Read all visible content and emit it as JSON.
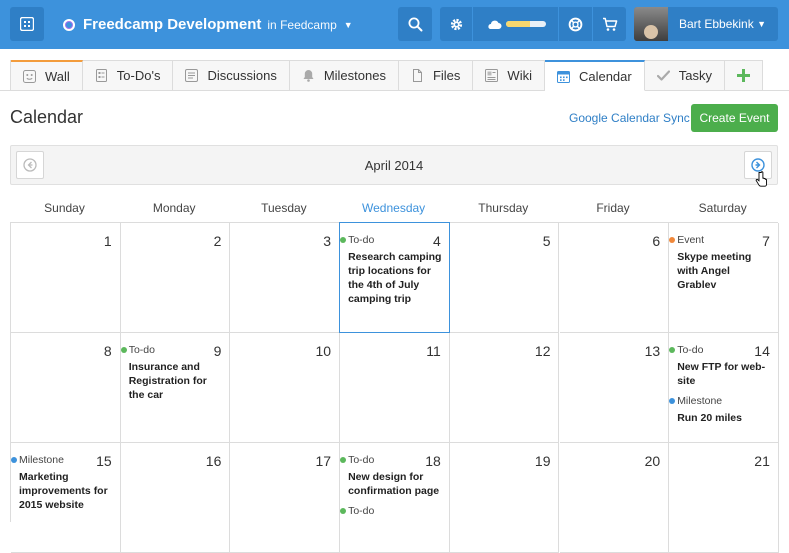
{
  "topbar": {
    "project_name": "Freedcamp Development",
    "project_in": "in Feedcamp",
    "user_name": "Bart Ebbekink",
    "storage_fraction": 0.6
  },
  "tabs": [
    {
      "label": "Wall",
      "icon": "smiley-icon"
    },
    {
      "label": "To-Do's",
      "icon": "todo-icon"
    },
    {
      "label": "Discussions",
      "icon": "discussion-icon"
    },
    {
      "label": "Milestones",
      "icon": "bell-icon"
    },
    {
      "label": "Files",
      "icon": "file-icon"
    },
    {
      "label": "Wiki",
      "icon": "wiki-icon"
    },
    {
      "label": "Calendar",
      "icon": "calendar-icon"
    },
    {
      "label": "Tasky",
      "icon": "check-icon"
    }
  ],
  "header": {
    "title": "Calendar",
    "gcal_sync": "Google Calendar Sync",
    "create_event": "Create Event"
  },
  "calendar": {
    "month_label": "April 2014",
    "days_of_week": [
      "Sunday",
      "Monday",
      "Tuesday",
      "Wednesday",
      "Thursday",
      "Friday",
      "Saturday"
    ],
    "today_dow_index": 3,
    "weeks": [
      [
        {
          "day": "1",
          "events": []
        },
        {
          "day": "2",
          "events": []
        },
        {
          "day": "3",
          "events": []
        },
        {
          "day": "4",
          "today": true,
          "events": [
            {
              "type": "To-do",
              "color": "#5cb85c",
              "title": "Research camping trip locations for the 4th of July camping trip"
            }
          ]
        },
        {
          "day": "5",
          "events": []
        },
        {
          "day": "6",
          "events": []
        },
        {
          "day": "7",
          "events": [
            {
              "type": "Event",
              "color": "#f0883a",
              "title": "Skype meeting with Angel Grablev"
            }
          ]
        }
      ],
      [
        {
          "day": "8",
          "events": []
        },
        {
          "day": "9",
          "events": [
            {
              "type": "To-do",
              "color": "#5cb85c",
              "title": "Insurance and Registration for the car"
            }
          ]
        },
        {
          "day": "10",
          "events": []
        },
        {
          "day": "11",
          "events": []
        },
        {
          "day": "12",
          "events": []
        },
        {
          "day": "13",
          "events": []
        },
        {
          "day": "14",
          "events": [
            {
              "type": "To-do",
              "color": "#5cb85c",
              "title": "New FTP for web-site"
            },
            {
              "type": "Milestone",
              "color": "#3d92dc",
              "title": "Run 20 miles"
            }
          ]
        }
      ],
      [
        {
          "day": "15",
          "events": [
            {
              "type": "Milestone",
              "color": "#3d92dc",
              "title": "Marketing improvements for 2015 website"
            }
          ]
        },
        {
          "day": "16",
          "events": []
        },
        {
          "day": "17",
          "events": []
        },
        {
          "day": "18",
          "events": [
            {
              "type": "To-do",
              "color": "#5cb85c",
              "title": "New design for confirmation page"
            },
            {
              "type": "To-do",
              "color": "#5cb85c",
              "title": ""
            }
          ]
        },
        {
          "day": "19",
          "events": []
        },
        {
          "day": "20",
          "events": []
        },
        {
          "day": "21",
          "events": []
        }
      ]
    ]
  }
}
